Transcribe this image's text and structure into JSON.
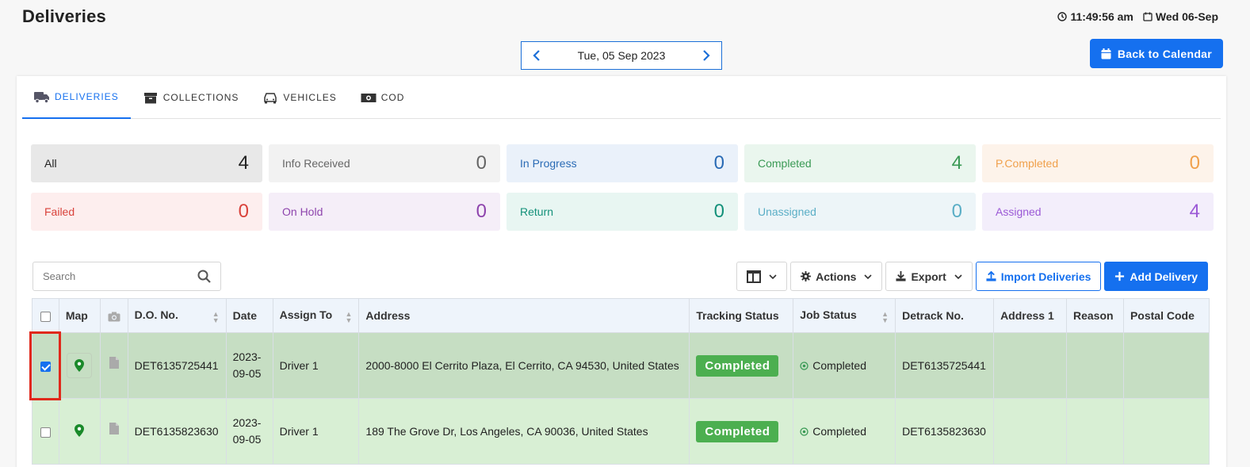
{
  "header": {
    "title": "Deliveries",
    "time": "11:49:56 am",
    "date": "Wed 06-Sep"
  },
  "date_nav": {
    "current": "Tue, 05 Sep 2023"
  },
  "back_button": "Back to Calendar",
  "tabs": [
    {
      "label": "DELIVERIES",
      "icon": "truck-icon",
      "active": true
    },
    {
      "label": "COLLECTIONS",
      "icon": "archive-box-icon",
      "active": false
    },
    {
      "label": "VEHICLES",
      "icon": "car-icon",
      "active": false
    },
    {
      "label": "COD",
      "icon": "money-bill-icon",
      "active": false
    }
  ],
  "status_tiles": [
    {
      "label": "All",
      "count": "4",
      "bg": "#e8e8e8",
      "color": "#222"
    },
    {
      "label": "Info Received",
      "count": "0",
      "bg": "#f2f2f2",
      "color": "#666"
    },
    {
      "label": "In Progress",
      "count": "0",
      "bg": "#eaf1fa",
      "color": "#2a6bb5"
    },
    {
      "label": "Completed",
      "count": "4",
      "bg": "#eaf6ee",
      "color": "#3a9a55"
    },
    {
      "label": "P.Completed",
      "count": "0",
      "bg": "#fdf3ea",
      "color": "#f0a04b"
    },
    {
      "label": "Failed",
      "count": "0",
      "bg": "#fdeeee",
      "color": "#d9423b"
    },
    {
      "label": "On Hold",
      "count": "0",
      "bg": "#f5eef8",
      "color": "#8e44ad"
    },
    {
      "label": "Return",
      "count": "0",
      "bg": "#e8f6f2",
      "color": "#14917a"
    },
    {
      "label": "Unassigned",
      "count": "0",
      "bg": "#edf5f8",
      "color": "#5aaec6"
    },
    {
      "label": "Assigned",
      "count": "4",
      "bg": "#f3eefb",
      "color": "#9b59d6"
    }
  ],
  "search": {
    "placeholder": "Search"
  },
  "toolbar": {
    "actions": "Actions",
    "export": "Export",
    "import": "Import Deliveries",
    "add": "Add Delivery"
  },
  "table": {
    "columns": [
      "Map",
      "D.O. No.",
      "Date",
      "Assign To",
      "Address",
      "Tracking Status",
      "Job Status",
      "Detrack No.",
      "Address 1",
      "Reason",
      "Postal Code"
    ],
    "rows": [
      {
        "selected": true,
        "do_no": "DET6135725441",
        "date_line1": "2023-",
        "date_line2": "09-05",
        "assign_to": "Driver 1",
        "address": "2000-8000 El Cerrito Plaza, El Cerrito, CA 94530, United States",
        "tracking_status": "Completed",
        "job_status": "Completed",
        "detrack_no": "DET6135725441",
        "address_1": "",
        "reason": "",
        "postal_code": ""
      },
      {
        "selected": false,
        "do_no": "DET6135823630",
        "date_line1": "2023-",
        "date_line2": "09-05",
        "assign_to": "Driver 1",
        "address": "189 The Grove Dr, Los Angeles, CA 90036, United States",
        "tracking_status": "Completed",
        "job_status": "Completed",
        "detrack_no": "DET6135823630",
        "address_1": "",
        "reason": "",
        "postal_code": ""
      }
    ]
  },
  "colors": {
    "accent": "#1570ef",
    "completed_badge": "#4caf50",
    "selected_row": "#c6dec3",
    "row": "#d8efd4",
    "highlight": "#e0281b"
  }
}
